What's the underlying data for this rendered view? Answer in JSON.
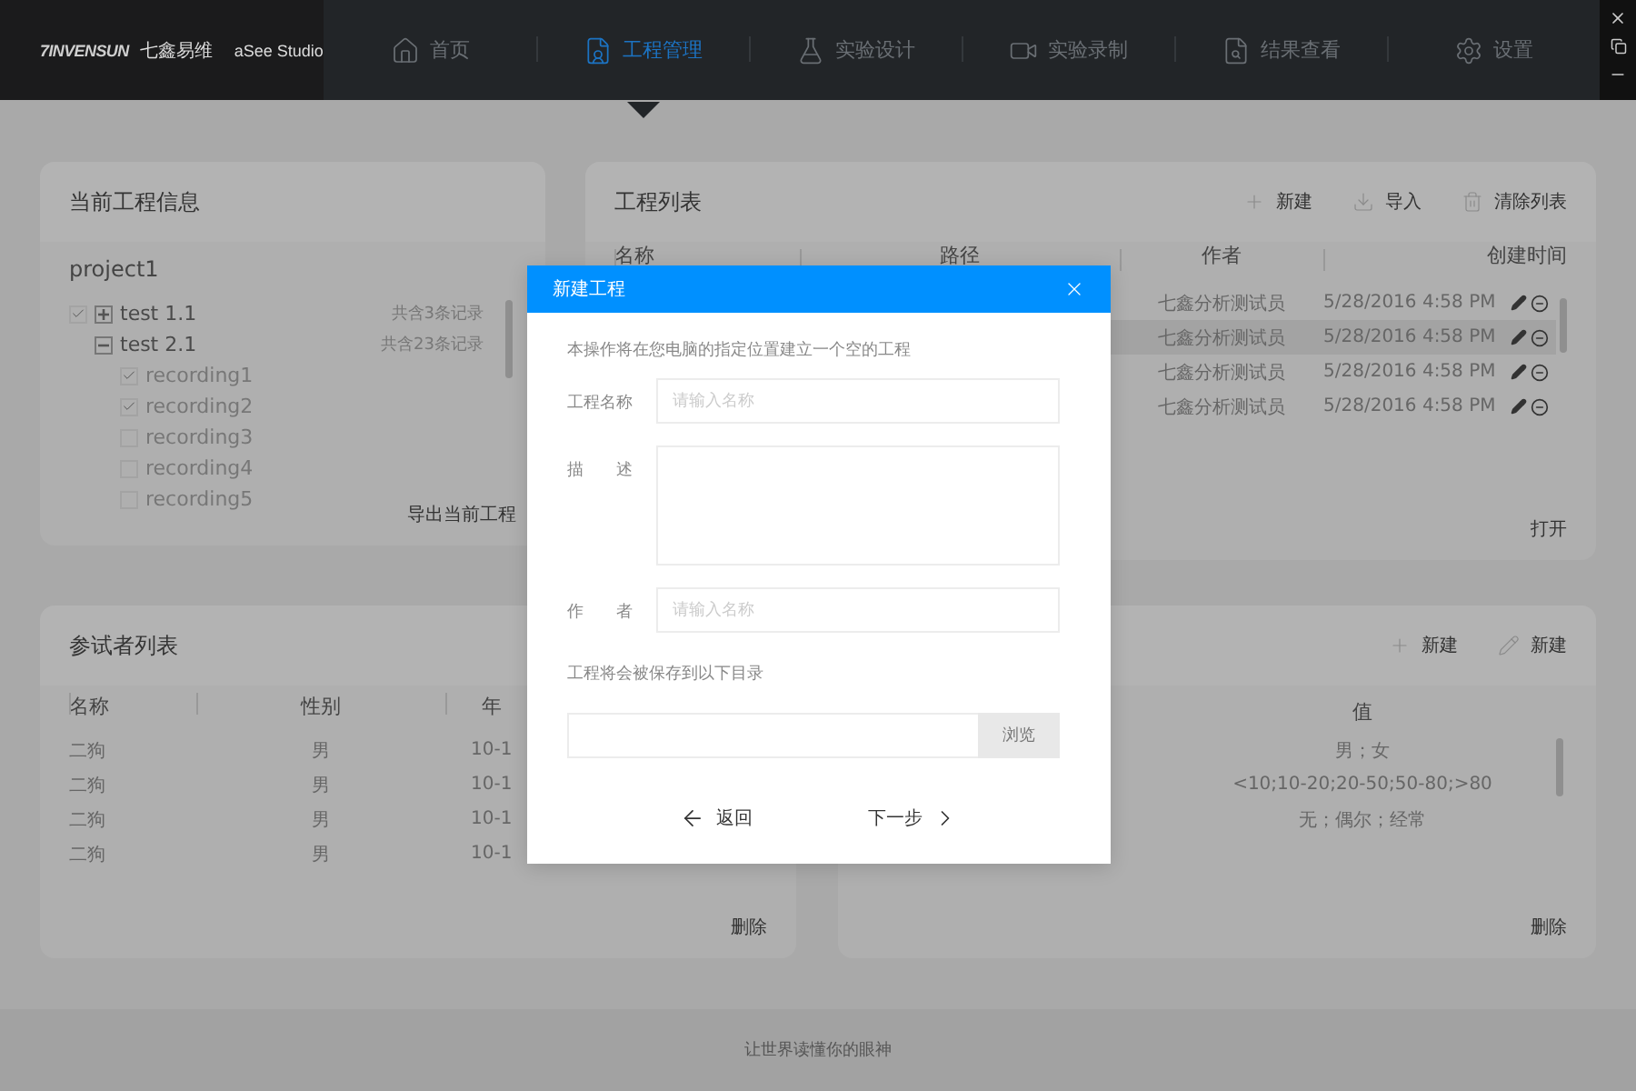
{
  "brand": {
    "logo": "7INVENSUN",
    "company": "七鑫易维",
    "product": "aSee Studio"
  },
  "nav": [
    {
      "label": "首页",
      "selected": false
    },
    {
      "label": "工程管理",
      "selected": true
    },
    {
      "label": "实验设计",
      "selected": false
    },
    {
      "label": "实验录制",
      "selected": false
    },
    {
      "label": "结果查看",
      "selected": false
    },
    {
      "label": "设置",
      "selected": false
    }
  ],
  "project_info": {
    "title": "当前工程信息",
    "project": "project1",
    "tree": [
      {
        "kind": "checkable",
        "label": "test 1.1",
        "count": "共含3条记录",
        "checked": true,
        "expanded": false
      },
      {
        "kind": "plain",
        "label": "test 2.1",
        "count": "共含23条记录",
        "expanded": true,
        "children": [
          {
            "label": "recording1",
            "checked": true
          },
          {
            "label": "recording2",
            "checked": true
          },
          {
            "label": "recording3",
            "checked": false
          },
          {
            "label": "recording4",
            "checked": false
          },
          {
            "label": "recording5",
            "checked": false
          }
        ]
      }
    ],
    "button": "导出当前工程"
  },
  "project_list": {
    "title": "工程列表",
    "actions": [
      "新建",
      "导入",
      "清除列表"
    ],
    "columns": [
      "名称",
      "路径",
      "作者",
      "创建时间"
    ],
    "rows": [
      {
        "author": "七鑫分析测试员",
        "created": "5/28/2016 4:58 PM",
        "selected": false
      },
      {
        "author": "七鑫分析测试员",
        "created": "5/28/2016 4:58 PM",
        "selected": true
      },
      {
        "author": "七鑫分析测试员",
        "created": "5/28/2016 4:58 PM",
        "selected": false
      },
      {
        "author": "七鑫分析测试员",
        "created": "5/28/2016 4:58 PM",
        "selected": false
      }
    ],
    "button": "打开"
  },
  "participants": {
    "title": "参试者列表",
    "columns": [
      "名称",
      "性别",
      "年"
    ],
    "rows": [
      {
        "name": "二狗",
        "gender": "男",
        "age": "10-1"
      },
      {
        "name": "二狗",
        "gender": "男",
        "age": "10-1"
      },
      {
        "name": "二狗",
        "gender": "男",
        "age": "10-1"
      },
      {
        "name": "二狗",
        "gender": "男",
        "age": "10-1"
      }
    ],
    "button": "删除"
  },
  "variables": {
    "actions": [
      "新建",
      "新建"
    ],
    "column": "值",
    "rows": [
      "男；女",
      "<10;10-20;20-50;50-80;>80",
      "无；偶尔；经常"
    ],
    "button": "删除"
  },
  "dialog": {
    "title": "新建工程",
    "intro": "本操作将在您电脑的指定位置建立一个空的工程",
    "fields": [
      {
        "kind": "input",
        "label": "工程名称",
        "placeholder": "请输入名称"
      },
      {
        "kind": "textarea",
        "label": "描　　述"
      },
      {
        "kind": "input",
        "label": "作　　者",
        "placeholder": "请输入名称"
      }
    ],
    "folder_label": "工程将会被保存到以下目录",
    "browse": "浏览",
    "back": "返回",
    "next": "下一步"
  },
  "footer": "让世界读懂你的眼神"
}
